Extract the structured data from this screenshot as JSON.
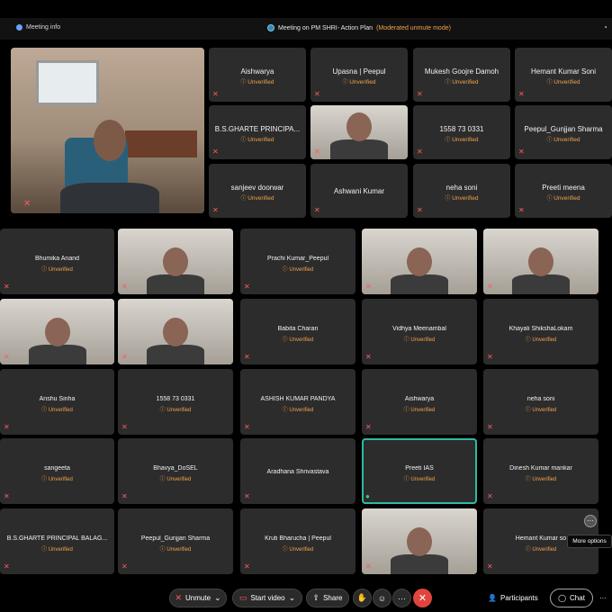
{
  "titlebar": {
    "meeting_info": "Meeting info",
    "meeting_title": "Meeting on PM SHRI- Action Plan",
    "moderated": "(Moderated unmute mode)"
  },
  "unverified_label": "Unverified",
  "top_grid": [
    {
      "name": "Aishwarya",
      "unverified": true
    },
    {
      "name": "Upasna | Peepul",
      "unverified": true
    },
    {
      "name": "Mukesh Goojre Damoh",
      "unverified": true
    },
    {
      "name": "Hemant Kumar Soni",
      "unverified": true
    },
    {
      "name": "B.S.GHARTE PRINCIPA...",
      "unverified": true
    },
    {
      "name": "",
      "video": true
    },
    {
      "name": "1558 73 0331",
      "unverified": true
    },
    {
      "name": "Peepul_Gunjjan Sharma",
      "unverified": true
    },
    {
      "name": "sanjeev doorwar",
      "unverified": true
    },
    {
      "name": "Ashwani Kumar",
      "unverified": false
    },
    {
      "name": "neha soni",
      "unverified": true
    },
    {
      "name": "Preeti meena",
      "unverified": true
    }
  ],
  "bottom_grid": [
    [
      {
        "name": "Bhumika Anand",
        "unverified": true
      },
      {
        "name": "",
        "video": true
      },
      {
        "name": "Prachi Kumar_Peepul",
        "unverified": true
      },
      {
        "name": "",
        "video": true
      },
      {
        "name": "",
        "video": true
      }
    ],
    [
      {
        "name": "",
        "video": true
      },
      {
        "name": "",
        "video": true
      },
      {
        "name": "Babita Charan",
        "unverified": true
      },
      {
        "name": "Vidhya Meenambal",
        "unverified": true
      },
      {
        "name": "Khayali ShikshaLokam",
        "unverified": true
      }
    ],
    [
      {
        "name": "Anshu Sinha",
        "unverified": true
      },
      {
        "name": "1558 73 0331",
        "unverified": true
      },
      {
        "name": "ASHISH KUMAR PANDYA",
        "unverified": true
      },
      {
        "name": "Aishwarya",
        "unverified": true
      },
      {
        "name": "neha soni",
        "unverified": true
      }
    ],
    [
      {
        "name": "sangeeta",
        "unverified": true
      },
      {
        "name": "Bhavya_DoSEL",
        "unverified": true
      },
      {
        "name": "Aradhana  Shrivastava",
        "unverified": false
      },
      {
        "name": "Preeti IAS",
        "unverified": true
      },
      {
        "name": "Dinesh Kumar mankar",
        "unverified": true
      }
    ],
    [
      {
        "name": "B.S.GHARTE PRINCIPAL BALAG...",
        "unverified": true
      },
      {
        "name": "Peepul_Gunjjan Sharma",
        "unverified": true
      },
      {
        "name": "Kruti Bharucha | Peepul",
        "unverified": true
      },
      {
        "name": "",
        "video": true
      },
      {
        "name": "Hemant Kumar so",
        "unverified": true
      }
    ]
  ],
  "tooltip": "More options",
  "toolbar": {
    "unmute": "Unmute",
    "start_video": "Start video",
    "share": "Share",
    "participants": "Participants",
    "chat": "Chat"
  }
}
